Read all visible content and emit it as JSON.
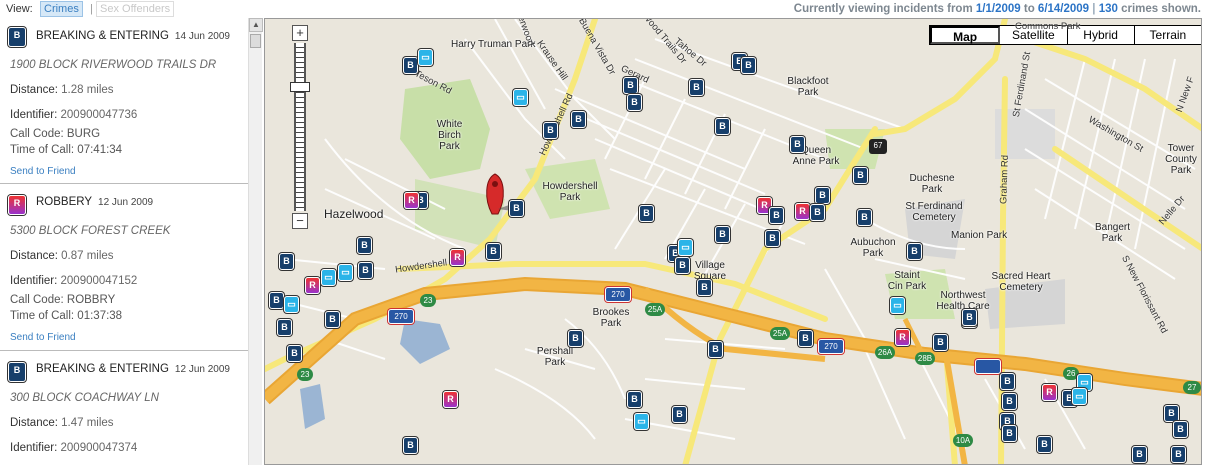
{
  "topbar": {
    "view_label": "View:",
    "tab_crimes": "Crimes",
    "separator": "|",
    "tab_sex_offenders": "Sex Offenders",
    "status_prefix": "Currently viewing incidents from",
    "date_from": "1/1/2009",
    "to_word": "to",
    "date_to": "6/14/2009",
    "divider": "|",
    "count": "130",
    "status_suffix": "crimes shown."
  },
  "entries": [
    {
      "badge": "B",
      "type": "BREAKING & ENTERING",
      "date": "14 Jun 2009",
      "address": "1900 BLOCK RIVERWOOD TRAILS DR",
      "distance_label": "Distance:",
      "distance": "1.28 miles",
      "identifier_label": "Identifier:",
      "identifier": "200900047736",
      "call_code": "Call Code: BURG",
      "time_of_call": "Time of Call: 07:41:34",
      "send": "Send to Friend"
    },
    {
      "badge": "R",
      "type": "ROBBERY",
      "date": "12 Jun 2009",
      "address": "5300 BLOCK FOREST CREEK",
      "distance_label": "Distance:",
      "distance": "0.87 miles",
      "identifier_label": "Identifier:",
      "identifier": "200900047152",
      "call_code": "Call Code: ROBBRY",
      "time_of_call": "Time of Call: 01:37:38",
      "send": "Send to Friend"
    },
    {
      "badge": "B",
      "type": "BREAKING & ENTERING",
      "date": "12 Jun 2009",
      "address": "300 BLOCK COACHWAY LN",
      "distance_label": "Distance:",
      "distance": "1.47 miles",
      "identifier_label": "Identifier:",
      "identifier": "200900047374"
    }
  ],
  "map": {
    "types": [
      "Map",
      "Satellite",
      "Hybrid",
      "Terrain"
    ],
    "selected_type": "Map",
    "zoom_in": "+",
    "zoom_out": "−",
    "places": {
      "harry_truman_park": "Harry Truman Park",
      "white_birch_park": "White Birch Park",
      "hazelwood": "Hazelwood",
      "howdershell_park": "Howdershell Park",
      "blackfoot_park": "Blackfoot Park",
      "queen_anne_park": "Queen Anne Park",
      "duchesne_park": "Duchesne Park",
      "st_ferdinand_cemetery": "St Ferdinand Cemetery",
      "manion_park": "Manion Park",
      "aubuchon_park": "Aubuchon Park",
      "staint_cin_park": "Staint Cin Park",
      "village_square": "Village Square",
      "brookes_park": "Brookes Park",
      "pershall_park": "Pershall Park",
      "northwest_health_care": "Northwest Health Care",
      "sacred_heart_cemetery": "Sacred Heart Cemetery",
      "bangert_park": "Bangert Park",
      "tower_county_park": "Tower County Park"
    },
    "streets": {
      "teson_rd": "Teson Rd",
      "howdershell_rd": "Howdershell Rd",
      "howdershell": "Howdershell",
      "st_ferdinand_st": "St Ferdinand St",
      "graham_rd": "Graham Rd",
      "washington_st": "Washington St",
      "s_new_florissant_rd": "S New Florissant Rd",
      "n_new_f": "N New F",
      "gerard": "Gerard",
      "tahoe_dr": "Tahoe Dr",
      "krause_hill": "Krause Hill",
      "buena_vista": "Buena Vista Dr",
      "wood_trails": "Wood Trails Dr",
      "commons": "Commons Park",
      "nelle": "Nelle Dr",
      "riverwood": "Riverwood"
    },
    "route_shields": [
      "270",
      "270",
      "270",
      "67",
      "23",
      "23",
      "25A",
      "25A",
      "26A",
      "28B",
      "27",
      "26",
      "10A"
    ]
  },
  "colors": {
    "burglary": "#173f6b",
    "robbery": "#9933cc",
    "vehicle": "#2bb4e8",
    "highway": "#f2b544",
    "major_road": "#f7e87a",
    "park": "#c8dfa8",
    "water": "#9bb5d3",
    "link": "#2c74c6"
  }
}
